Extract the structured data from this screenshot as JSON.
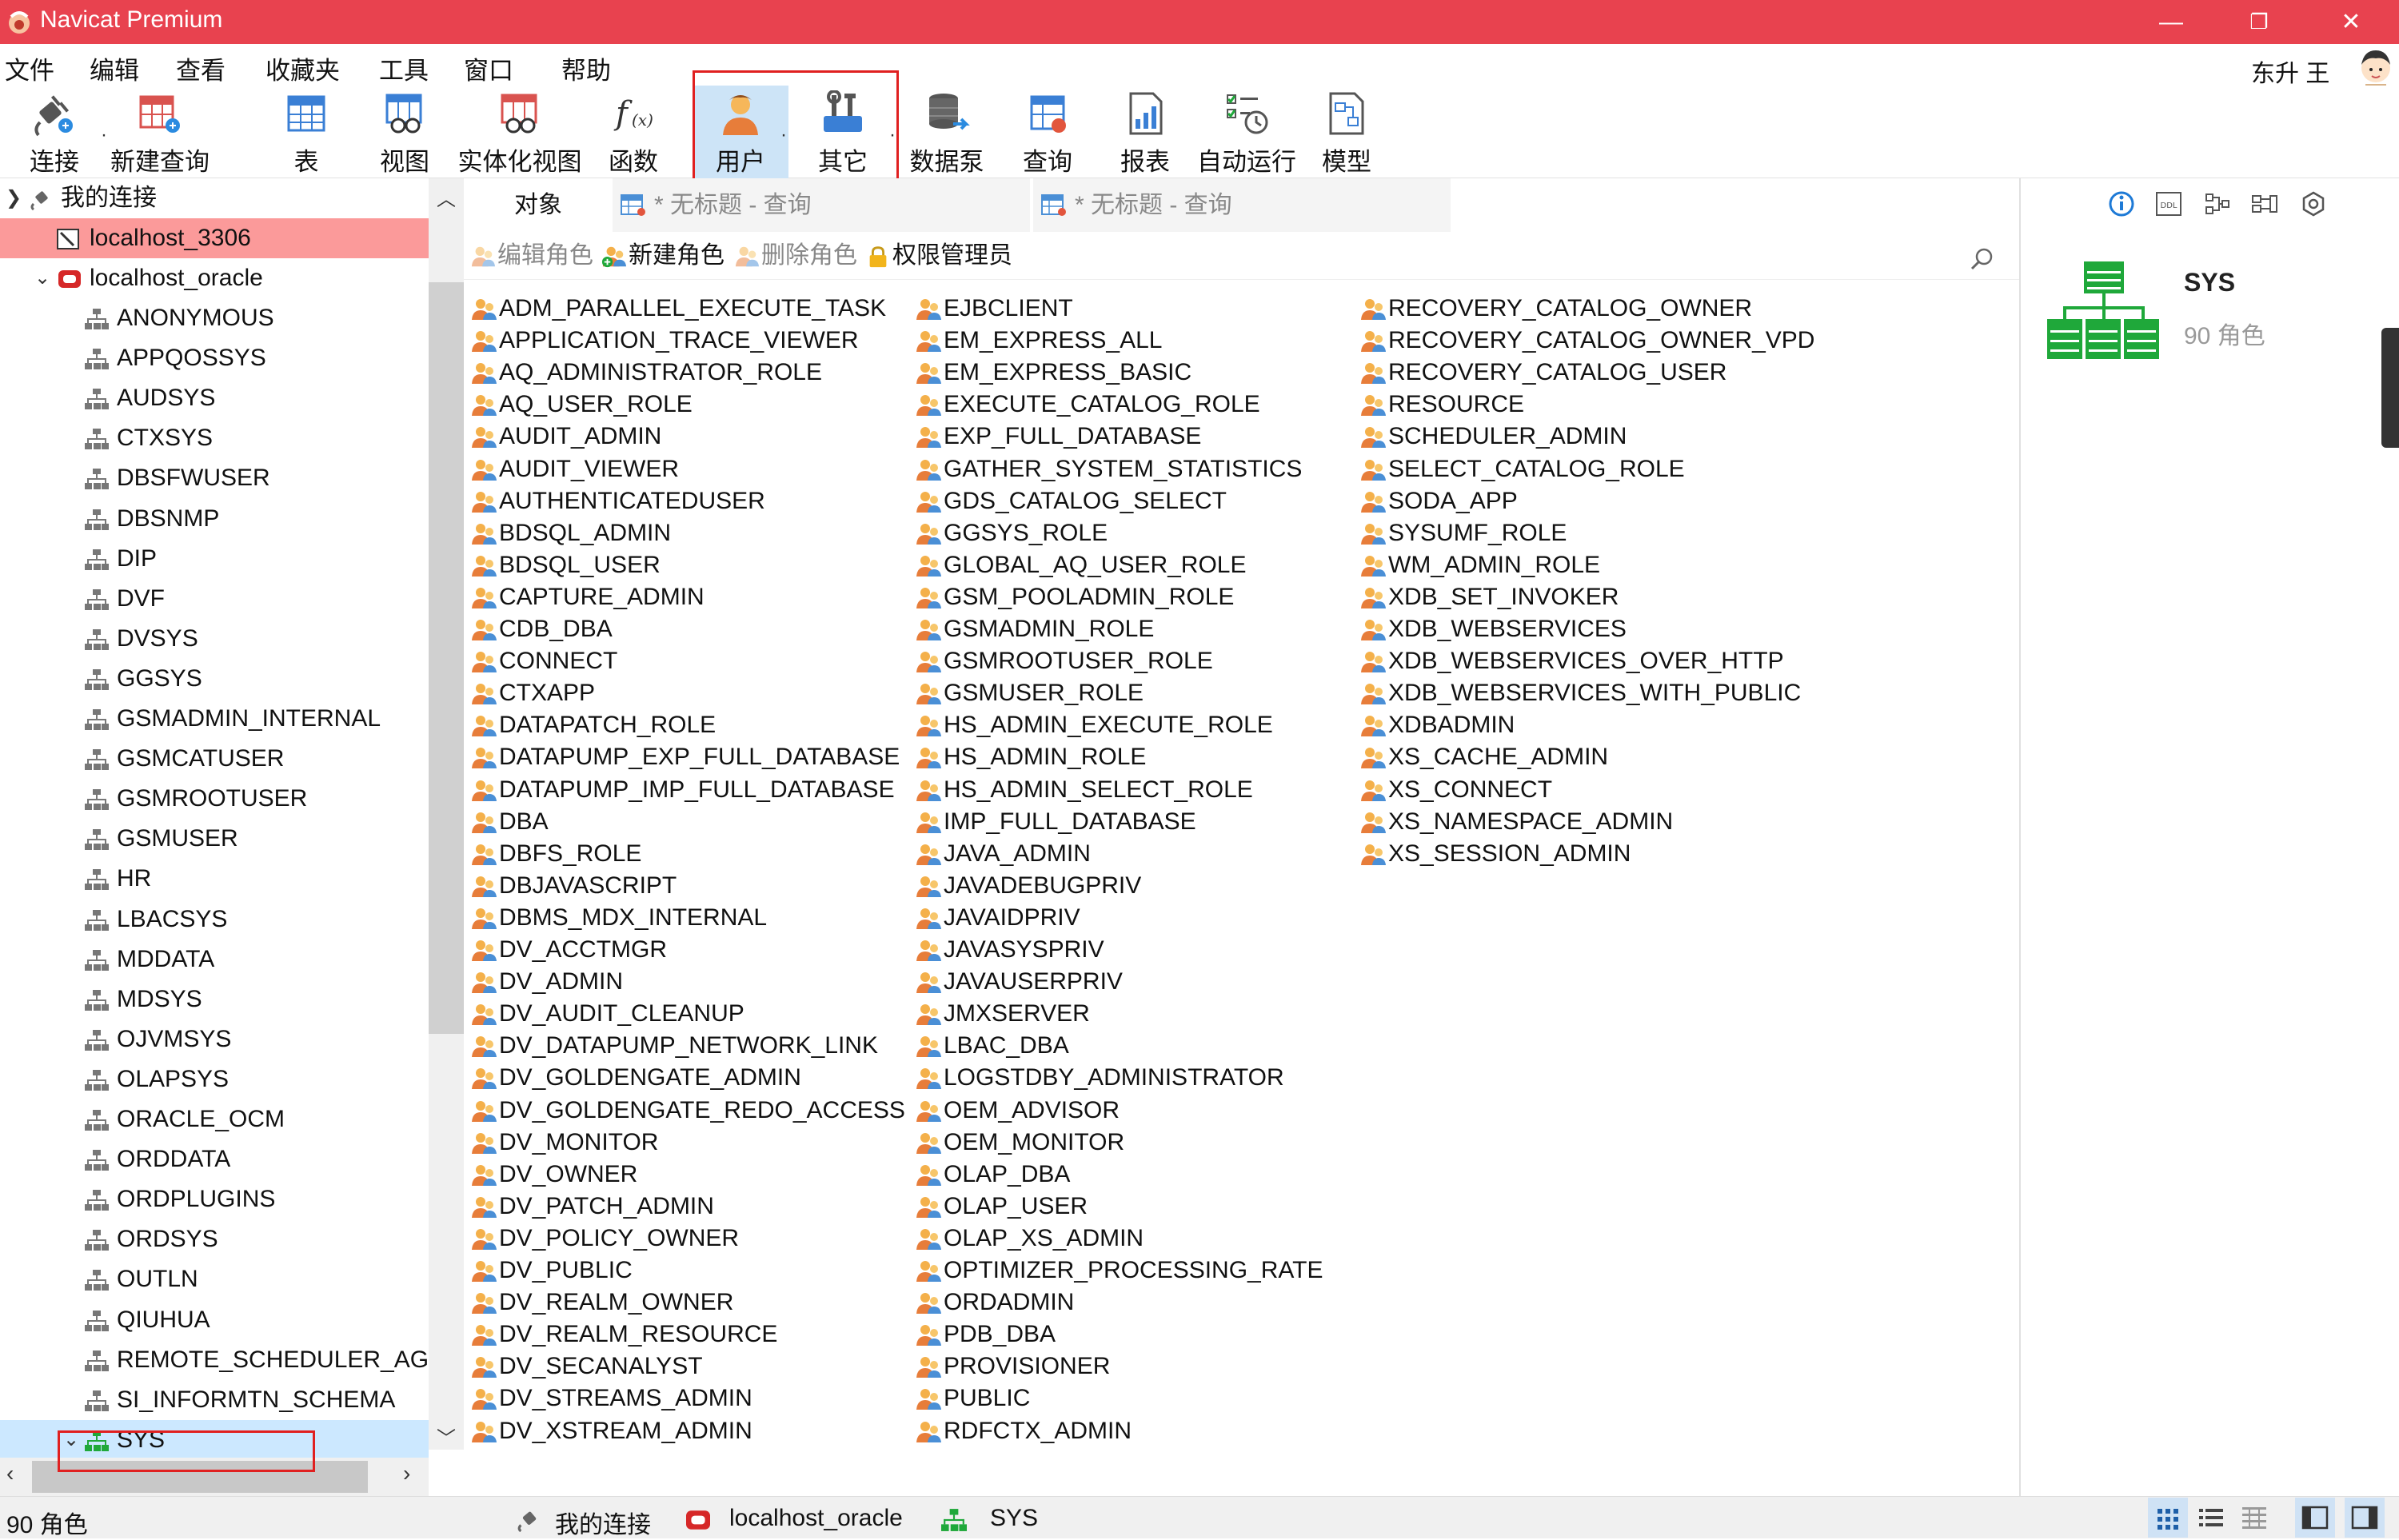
{
  "window": {
    "title": "Navicat Premium",
    "controls": [
      "—",
      "❐",
      "✕"
    ]
  },
  "menu": [
    "文件",
    "编辑",
    "查看",
    "收藏夹",
    "工具",
    "窗口",
    "帮助"
  ],
  "user": {
    "name": "东升 王"
  },
  "toolbar": [
    {
      "id": "connect",
      "label": "连接",
      "icon": "plug-icon"
    },
    {
      "id": "new-query",
      "label": "新建查询",
      "icon": "new-query-icon"
    },
    {
      "id": "table",
      "label": "表",
      "icon": "table-icon"
    },
    {
      "id": "view",
      "label": "视图",
      "icon": "view-icon"
    },
    {
      "id": "mview",
      "label": "实体化视图",
      "icon": "materialized-view-icon"
    },
    {
      "id": "function",
      "label": "函数",
      "icon": "function-icon"
    },
    {
      "id": "user",
      "label": "用户",
      "icon": "user-icon",
      "active": true
    },
    {
      "id": "other",
      "label": "其它",
      "icon": "tools-icon"
    },
    {
      "id": "pump",
      "label": "数据泵",
      "icon": "data-pump-icon"
    },
    {
      "id": "query",
      "label": "查询",
      "icon": "query-icon"
    },
    {
      "id": "report",
      "label": "报表",
      "icon": "report-icon"
    },
    {
      "id": "auto",
      "label": "自动运行",
      "icon": "schedule-icon"
    },
    {
      "id": "model",
      "label": "模型",
      "icon": "model-icon"
    }
  ],
  "tree": {
    "root": "我的连接",
    "connections": [
      {
        "name": "localhost_3306",
        "type": "mysql"
      },
      {
        "name": "localhost_oracle",
        "type": "oracle"
      }
    ],
    "schemas": [
      "ANONYMOUS",
      "APPQOSSYS",
      "AUDSYS",
      "CTXSYS",
      "DBSFWUSER",
      "DBSNMP",
      "DIP",
      "DVF",
      "DVSYS",
      "GGSYS",
      "GSMADMIN_INTERNAL",
      "GSMCATUSER",
      "GSMROOTUSER",
      "GSMUSER",
      "HR",
      "LBACSYS",
      "MDDATA",
      "MDSYS",
      "OJVMSYS",
      "OLAPSYS",
      "ORACLE_OCM",
      "ORDDATA",
      "ORDPLUGINS",
      "ORDSYS",
      "OUTLN",
      "QIUHUA",
      "REMOTE_SCHEDULER_AGE",
      "SI_INFORMTN_SCHEMA",
      "SYS"
    ]
  },
  "tabs": [
    {
      "label": "对象"
    },
    {
      "label": "* 无标题 - 查询"
    },
    {
      "label": "* 无标题 - 查询"
    }
  ],
  "object_toolbar": {
    "edit_role": "编辑角色",
    "new_role": "新建角色",
    "delete_role": "删除角色",
    "privilege_manager": "权限管理员"
  },
  "roles": {
    "col1": [
      "ADM_PARALLEL_EXECUTE_TASK",
      "APPLICATION_TRACE_VIEWER",
      "AQ_ADMINISTRATOR_ROLE",
      "AQ_USER_ROLE",
      "AUDIT_ADMIN",
      "AUDIT_VIEWER",
      "AUTHENTICATEDUSER",
      "BDSQL_ADMIN",
      "BDSQL_USER",
      "CAPTURE_ADMIN",
      "CDB_DBA",
      "CONNECT",
      "CTXAPP",
      "DATAPATCH_ROLE",
      "DATAPUMP_EXP_FULL_DATABASE",
      "DATAPUMP_IMP_FULL_DATABASE",
      "DBA",
      "DBFS_ROLE",
      "DBJAVASCRIPT",
      "DBMS_MDX_INTERNAL",
      "DV_ACCTMGR",
      "DV_ADMIN",
      "DV_AUDIT_CLEANUP",
      "DV_DATAPUMP_NETWORK_LINK",
      "DV_GOLDENGATE_ADMIN",
      "DV_GOLDENGATE_REDO_ACCESS",
      "DV_MONITOR",
      "DV_OWNER",
      "DV_PATCH_ADMIN",
      "DV_POLICY_OWNER",
      "DV_PUBLIC",
      "DV_REALM_OWNER",
      "DV_REALM_RESOURCE",
      "DV_SECANALYST",
      "DV_STREAMS_ADMIN",
      "DV_XSTREAM_ADMIN"
    ],
    "col2": [
      "EJBCLIENT",
      "EM_EXPRESS_ALL",
      "EM_EXPRESS_BASIC",
      "EXECUTE_CATALOG_ROLE",
      "EXP_FULL_DATABASE",
      "GATHER_SYSTEM_STATISTICS",
      "GDS_CATALOG_SELECT",
      "GGSYS_ROLE",
      "GLOBAL_AQ_USER_ROLE",
      "GSM_POOLADMIN_ROLE",
      "GSMADMIN_ROLE",
      "GSMROOTUSER_ROLE",
      "GSMUSER_ROLE",
      "HS_ADMIN_EXECUTE_ROLE",
      "HS_ADMIN_ROLE",
      "HS_ADMIN_SELECT_ROLE",
      "IMP_FULL_DATABASE",
      "JAVA_ADMIN",
      "JAVADEBUGPRIV",
      "JAVAIDPRIV",
      "JAVASYSPRIV",
      "JAVAUSERPRIV",
      "JMXSERVER",
      "LBAC_DBA",
      "LOGSTDBY_ADMINISTRATOR",
      "OEM_ADVISOR",
      "OEM_MONITOR",
      "OLAP_DBA",
      "OLAP_USER",
      "OLAP_XS_ADMIN",
      "OPTIMIZER_PROCESSING_RATE",
      "ORDADMIN",
      "PDB_DBA",
      "PROVISIONER",
      "PUBLIC",
      "RDFCTX_ADMIN"
    ],
    "col3": [
      "RECOVERY_CATALOG_OWNER",
      "RECOVERY_CATALOG_OWNER_VPD",
      "RECOVERY_CATALOG_USER",
      "RESOURCE",
      "SCHEDULER_ADMIN",
      "SELECT_CATALOG_ROLE",
      "SODA_APP",
      "SYSUMF_ROLE",
      "WM_ADMIN_ROLE",
      "XDB_SET_INVOKER",
      "XDB_WEBSERVICES",
      "XDB_WEBSERVICES_OVER_HTTP",
      "XDB_WEBSERVICES_WITH_PUBLIC",
      "XDBADMIN",
      "XS_CACHE_ADMIN",
      "XS_CONNECT",
      "XS_NAMESPACE_ADMIN",
      "XS_SESSION_ADMIN"
    ]
  },
  "info": {
    "name": "SYS",
    "count": "90 角色",
    "tab_ddl": "DDL"
  },
  "status": {
    "count": "90 角色",
    "crumbs": [
      "我的连接",
      "localhost_oracle",
      "SYS"
    ]
  },
  "colors": {
    "titlebar": "#e8424f",
    "selected_connection": "#fb9a9a",
    "schema_green": "#1fa83a",
    "oracle_red": "#d62828",
    "accent_blue": "#1e7ad6"
  }
}
